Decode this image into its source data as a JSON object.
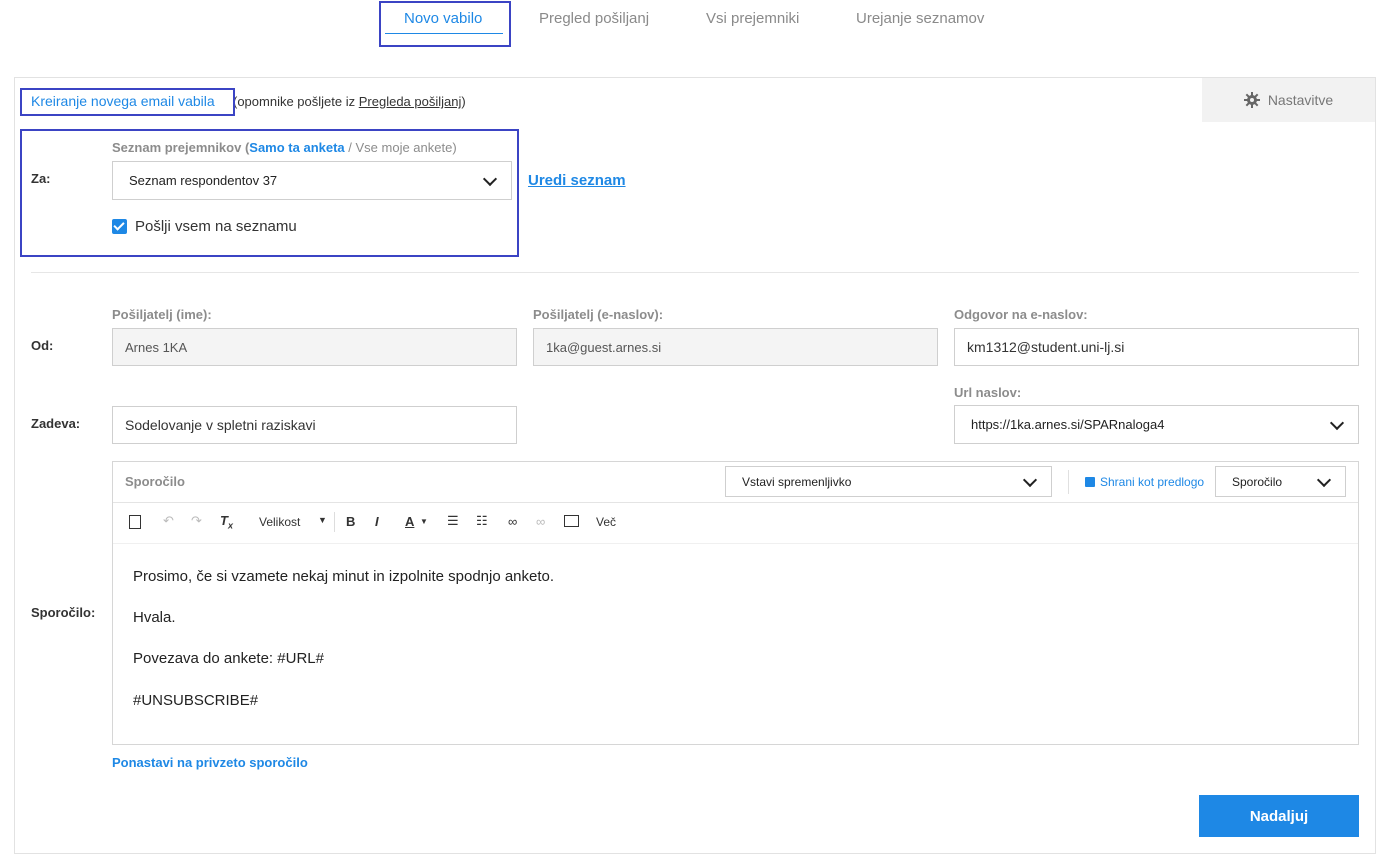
{
  "tabs": [
    {
      "label": "Novo vabilo"
    },
    {
      "label": "Pregled pošiljanj"
    },
    {
      "label": "Vsi prejemniki"
    },
    {
      "label": "Urejanje seznamov"
    }
  ],
  "header": {
    "create_link": "Kreiranje novega email vabila",
    "hint_prefix": "(opomnike pošljete iz ",
    "hint_link": "Pregleda pošiljanj",
    "hint_suffix": ")",
    "settings_label": "Nastavitve"
  },
  "to": {
    "label": "Za:",
    "list_label_prefix": "Seznam prejemnikov (",
    "list_label_active": "Samo ta anketa",
    "list_label_sep": " / ",
    "list_label_other": "Vse moje ankete",
    "list_label_suffix": ")",
    "selected_list": "Seznam respondentov 37",
    "edit_list_link": "Uredi seznam",
    "send_all_label": "Pošlji vsem na seznamu",
    "send_all_checked": true
  },
  "from": {
    "label": "Od:",
    "sender_name_label": "Pošiljatelj (ime):",
    "sender_name_value": "Arnes 1KA",
    "sender_email_label": "Pošiljatelj (e-naslov):",
    "sender_email_value": "1ka@guest.arnes.si",
    "reply_to_label": "Odgovor na e-naslov:",
    "reply_to_value": "km1312@student.uni-lj.si"
  },
  "subject": {
    "label": "Zadeva:",
    "value": "Sodelovanje v spletni raziskavi",
    "url_label": "Url naslov:",
    "url_value": "https://1ka.arnes.si/SPARnaloga4"
  },
  "message": {
    "label": "Sporočilo:",
    "editor_title": "Sporočilo",
    "insert_variable": "Vstavi spremenljivko",
    "save_template": "Shrani kot predlogo",
    "template_select": "Sporočilo",
    "toolbar": {
      "size": "Velikost",
      "more": "Več"
    },
    "lines": [
      "Prosimo, če si vzamete nekaj minut in izpolnite spodnjo anketo.",
      "Hvala.",
      "Povezava do ankete: #URL#",
      "#UNSUBSCRIBE#"
    ],
    "reset_link": "Ponastavi na privzeto sporočilo"
  },
  "actions": {
    "continue": "Nadaljuj"
  },
  "colors": {
    "accent": "#1e88e5",
    "highlight_box": "#3b44c4"
  }
}
